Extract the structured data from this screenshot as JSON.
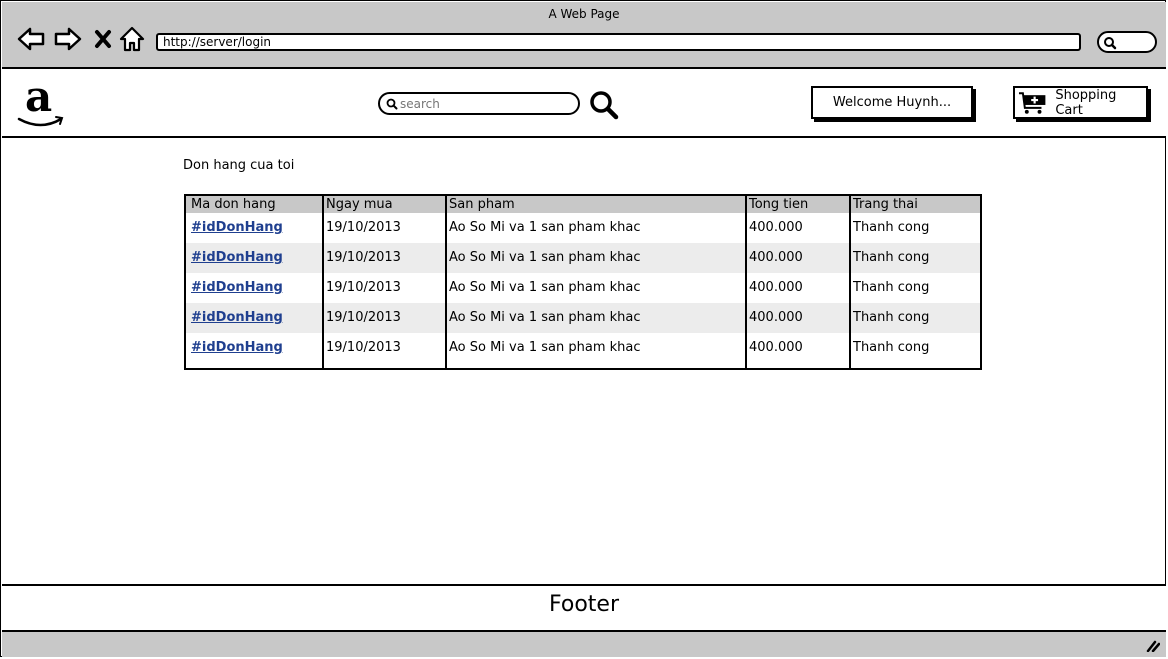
{
  "window": {
    "title": "A Web Page",
    "url": "http://server/login"
  },
  "header": {
    "search_placeholder": "search",
    "welcome_label": "Welcome Huynh...",
    "cart_label": "Shopping Cart"
  },
  "page": {
    "title": "Don hang cua toi"
  },
  "table": {
    "columns": [
      "Ma don hang",
      "Ngay mua",
      "San pham",
      "Tong tien",
      "Trang thai"
    ],
    "rows": [
      [
        "#idDonHang",
        "19/10/2013",
        "Ao So Mi va 1 san pham khac",
        "400.000",
        "Thanh cong"
      ],
      [
        "#idDonHang",
        "19/10/2013",
        "Ao So Mi va 1 san pham khac",
        "400.000",
        "Thanh cong"
      ],
      [
        "#idDonHang",
        "19/10/2013",
        "Ao So Mi va 1 san pham khac",
        "400.000",
        "Thanh cong"
      ],
      [
        "#idDonHang",
        "19/10/2013",
        "Ao So Mi va 1 san pham khac",
        "400.000",
        "Thanh cong"
      ],
      [
        "#idDonHang",
        "19/10/2013",
        "Ao So Mi va 1 san pham khac",
        "400.000",
        "Thanh cong"
      ]
    ]
  },
  "footer": {
    "label": "Footer"
  },
  "icons": {
    "back": "back-arrow-icon",
    "forward": "forward-arrow-icon",
    "stop": "close-icon",
    "home": "home-icon",
    "search": "search-icon",
    "cart": "shopping-cart-icon",
    "logo": "amazon-logo",
    "resize": "resize-grip-icon"
  }
}
